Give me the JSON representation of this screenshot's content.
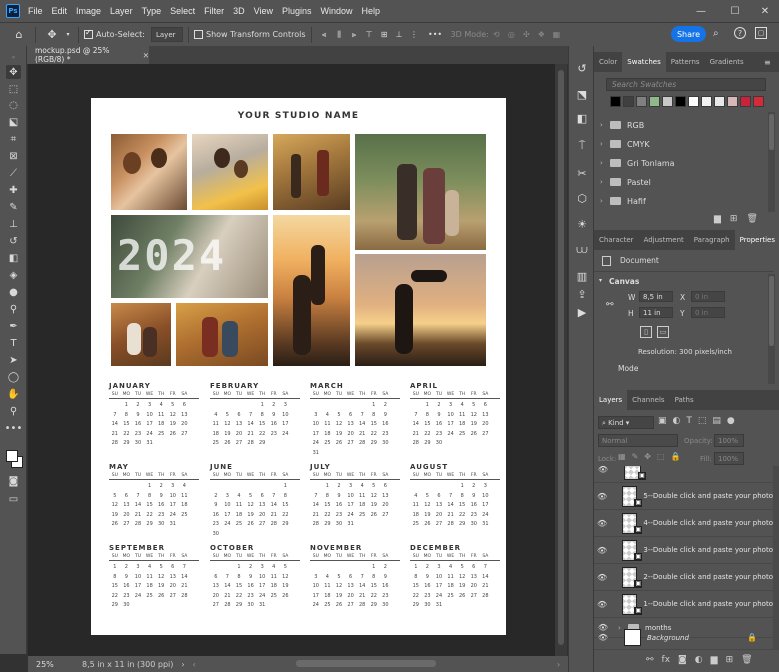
{
  "app": {
    "logo": "Ps",
    "menu": [
      "File",
      "Edit",
      "Image",
      "Layer",
      "Type",
      "Select",
      "Filter",
      "3D",
      "View",
      "Plugins",
      "Window",
      "Help"
    ]
  },
  "options": {
    "auto_select_label": "Auto-Select:",
    "auto_select_value": "Layer",
    "show_transform_label": "Show Transform Controls",
    "mode_3d": "3D Mode:",
    "share": "Share"
  },
  "document": {
    "tab_title": "mockup.psd @ 25% (RGB/8) *",
    "zoom": "25%",
    "status": "8,5 in x 11 in (300 ppi)"
  },
  "mockup": {
    "studio_name": "YOUR STUDIO NAME",
    "year": "2024",
    "dow": [
      "SU",
      "MO",
      "TU",
      "WE",
      "TH",
      "FR",
      "SA"
    ],
    "months": [
      {
        "name": "JANUARY",
        "weeks": [
          [
            "",
            "1",
            "2",
            "3",
            "4",
            "5",
            "6"
          ],
          [
            "7",
            "8",
            "9",
            "10",
            "11",
            "12",
            "13"
          ],
          [
            "14",
            "15",
            "16",
            "17",
            "18",
            "19",
            "20"
          ],
          [
            "21",
            "22",
            "23",
            "24",
            "25",
            "26",
            "27"
          ],
          [
            "28",
            "29",
            "30",
            "31",
            "",
            "",
            ""
          ]
        ]
      },
      {
        "name": "FEBRUARY",
        "weeks": [
          [
            "",
            "",
            "",
            "",
            "1",
            "2",
            "3"
          ],
          [
            "4",
            "5",
            "6",
            "7",
            "8",
            "9",
            "10"
          ],
          [
            "11",
            "12",
            "13",
            "14",
            "15",
            "16",
            "17"
          ],
          [
            "18",
            "19",
            "20",
            "21",
            "22",
            "23",
            "24"
          ],
          [
            "25",
            "26",
            "27",
            "28",
            "29",
            "",
            ""
          ]
        ]
      },
      {
        "name": "MARCH",
        "weeks": [
          [
            "",
            "",
            "",
            "",
            "",
            "1",
            "2"
          ],
          [
            "3",
            "4",
            "5",
            "6",
            "7",
            "8",
            "9"
          ],
          [
            "10",
            "11",
            "12",
            "13",
            "14",
            "15",
            "16"
          ],
          [
            "17",
            "18",
            "19",
            "20",
            "21",
            "22",
            "23"
          ],
          [
            "24",
            "25",
            "26",
            "27",
            "28",
            "29",
            "30"
          ],
          [
            "31",
            "",
            "",
            "",
            "",
            "",
            ""
          ]
        ]
      },
      {
        "name": "APRIL",
        "weeks": [
          [
            "",
            "1",
            "2",
            "3",
            "4",
            "5",
            "6"
          ],
          [
            "7",
            "8",
            "9",
            "10",
            "11",
            "12",
            "13"
          ],
          [
            "14",
            "15",
            "16",
            "17",
            "18",
            "19",
            "20"
          ],
          [
            "21",
            "22",
            "23",
            "24",
            "25",
            "26",
            "27"
          ],
          [
            "28",
            "29",
            "30",
            "",
            "",
            "",
            ""
          ]
        ]
      },
      {
        "name": "MAY",
        "weeks": [
          [
            "",
            "",
            "",
            "1",
            "2",
            "3",
            "4"
          ],
          [
            "5",
            "6",
            "7",
            "8",
            "9",
            "10",
            "11"
          ],
          [
            "12",
            "13",
            "14",
            "15",
            "16",
            "17",
            "18"
          ],
          [
            "19",
            "20",
            "21",
            "22",
            "23",
            "24",
            "25"
          ],
          [
            "26",
            "27",
            "28",
            "29",
            "30",
            "31",
            ""
          ]
        ]
      },
      {
        "name": "JUNE",
        "weeks": [
          [
            "",
            "",
            "",
            "",
            "",
            "",
            "1"
          ],
          [
            "2",
            "3",
            "4",
            "5",
            "6",
            "7",
            "8"
          ],
          [
            "9",
            "10",
            "11",
            "12",
            "13",
            "14",
            "15"
          ],
          [
            "16",
            "17",
            "18",
            "19",
            "20",
            "21",
            "22"
          ],
          [
            "23",
            "24",
            "25",
            "26",
            "27",
            "28",
            "29"
          ],
          [
            "30",
            "",
            "",
            "",
            "",
            "",
            ""
          ]
        ]
      },
      {
        "name": "JULY",
        "weeks": [
          [
            "",
            "1",
            "2",
            "3",
            "4",
            "5",
            "6"
          ],
          [
            "7",
            "8",
            "9",
            "10",
            "11",
            "12",
            "13"
          ],
          [
            "14",
            "15",
            "16",
            "17",
            "18",
            "19",
            "20"
          ],
          [
            "21",
            "22",
            "23",
            "24",
            "25",
            "26",
            "27"
          ],
          [
            "28",
            "29",
            "30",
            "31",
            "",
            "",
            ""
          ]
        ]
      },
      {
        "name": "AUGUST",
        "weeks": [
          [
            "",
            "",
            "",
            "",
            "1",
            "2",
            "3"
          ],
          [
            "4",
            "5",
            "6",
            "7",
            "8",
            "9",
            "10"
          ],
          [
            "11",
            "12",
            "13",
            "14",
            "15",
            "16",
            "17"
          ],
          [
            "18",
            "19",
            "20",
            "21",
            "22",
            "23",
            "24"
          ],
          [
            "25",
            "26",
            "27",
            "28",
            "29",
            "30",
            "31"
          ]
        ]
      },
      {
        "name": "SEPTEMBER",
        "weeks": [
          [
            "1",
            "2",
            "3",
            "4",
            "5",
            "6",
            "7"
          ],
          [
            "8",
            "9",
            "10",
            "11",
            "12",
            "13",
            "14"
          ],
          [
            "15",
            "16",
            "17",
            "18",
            "19",
            "20",
            "21"
          ],
          [
            "22",
            "23",
            "24",
            "25",
            "26",
            "27",
            "28"
          ],
          [
            "29",
            "30",
            "",
            "",
            "",
            "",
            ""
          ]
        ]
      },
      {
        "name": "OCTOBER",
        "weeks": [
          [
            "",
            "",
            "1",
            "2",
            "3",
            "4",
            "5"
          ],
          [
            "6",
            "7",
            "8",
            "9",
            "10",
            "11",
            "12"
          ],
          [
            "13",
            "14",
            "15",
            "16",
            "17",
            "18",
            "19"
          ],
          [
            "20",
            "21",
            "22",
            "23",
            "24",
            "25",
            "26"
          ],
          [
            "27",
            "28",
            "29",
            "30",
            "31",
            "",
            ""
          ]
        ]
      },
      {
        "name": "NOVEMBER",
        "weeks": [
          [
            "",
            "",
            "",
            "",
            "",
            "1",
            "2"
          ],
          [
            "3",
            "4",
            "5",
            "6",
            "7",
            "8",
            "9"
          ],
          [
            "10",
            "11",
            "12",
            "13",
            "14",
            "15",
            "16"
          ],
          [
            "17",
            "18",
            "19",
            "20",
            "21",
            "22",
            "23"
          ],
          [
            "24",
            "25",
            "26",
            "27",
            "28",
            "29",
            "30"
          ]
        ]
      },
      {
        "name": "DECEMBER",
        "weeks": [
          [
            "1",
            "2",
            "3",
            "4",
            "5",
            "6",
            "7"
          ],
          [
            "8",
            "9",
            "10",
            "11",
            "12",
            "13",
            "14"
          ],
          [
            "15",
            "16",
            "17",
            "18",
            "19",
            "20",
            "21"
          ],
          [
            "22",
            "23",
            "24",
            "25",
            "26",
            "27",
            "28"
          ],
          [
            "29",
            "30",
            "31",
            "",
            "",
            "",
            ""
          ]
        ]
      }
    ]
  },
  "swatches_panel": {
    "tabs": [
      "Color",
      "Swatches",
      "Patterns",
      "Gradients"
    ],
    "active": "Swatches",
    "search_placeholder": "Search Swatches",
    "colors": [
      "#000000",
      "#404040",
      "#808080",
      "#8fb98a",
      "#c8c8c8",
      "#000000",
      "#ffffff",
      "#f2f2f2",
      "#e8e8e8",
      "#d7b7b8",
      "#c9233b",
      "#d42a3a"
    ],
    "groups": [
      "RGB",
      "CMYK",
      "Gri Tonlama",
      "Pastel",
      "Hafif"
    ]
  },
  "properties_panel": {
    "tabs": [
      "Character",
      "Adjustment",
      "Paragraph",
      "Properties"
    ],
    "active": "Properties",
    "doc_label": "Document",
    "canvas_label": "Canvas",
    "w_label": "W",
    "w_value": "8,5 in",
    "h_label": "H",
    "h_value": "11 in",
    "x_label": "X",
    "x_value": "0 in",
    "y_label": "Y",
    "y_value": "0 in",
    "resolution": "Resolution: 300 pixels/inch",
    "mode_label": "Mode"
  },
  "layers_panel": {
    "tabs": [
      "Layers",
      "Channels",
      "Paths"
    ],
    "active": "Layers",
    "kind": "Kind",
    "blend": "Normal",
    "opacity_label": "Opacity:",
    "opacity_value": "100%",
    "lock_label": "Lock:",
    "fill_label": "Fill:",
    "fill_value": "100%",
    "layers": [
      {
        "name": "5--Double click and paste your photo",
        "type": "smart"
      },
      {
        "name": "4--Double click and paste your photo",
        "type": "smart"
      },
      {
        "name": "3--Double click and paste your photo",
        "type": "smart"
      },
      {
        "name": "2--Double click and paste your photo",
        "type": "smart"
      },
      {
        "name": "1--Double click and paste your photo",
        "type": "smart"
      },
      {
        "name": "months",
        "type": "group"
      },
      {
        "name": "Background",
        "type": "background"
      }
    ]
  }
}
